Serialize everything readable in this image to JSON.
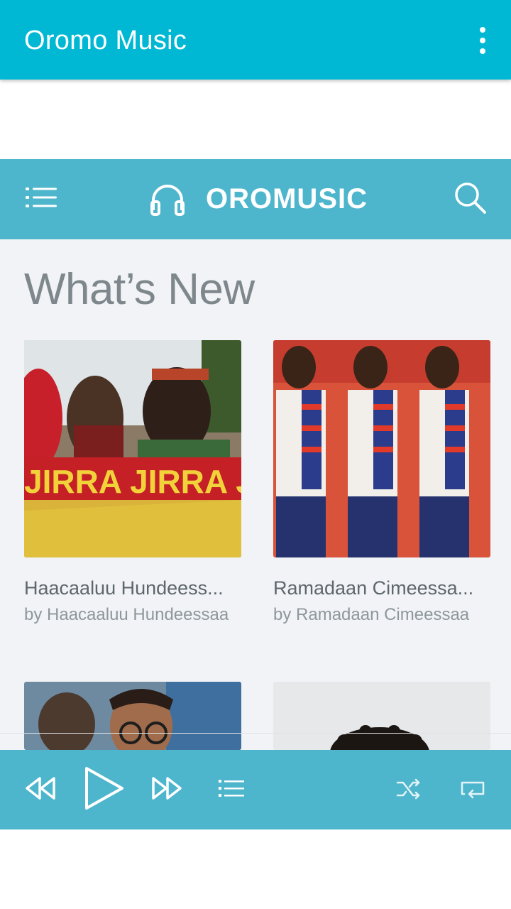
{
  "app": {
    "title": "Oromo Music"
  },
  "site": {
    "brand": "OROMUSIC",
    "section_title": "What’s New"
  },
  "cards": [
    {
      "title": "Haacaaluu Hundeess...",
      "artist": "by Haacaaluu Hundeessaa",
      "art_text": "JIRRA JIRRA J"
    },
    {
      "title": "Ramadaan Cimeessa...",
      "artist": "by Ramadaan Cimeessaa"
    },
    {
      "title": "",
      "artist": ""
    },
    {
      "title": "",
      "artist": ""
    }
  ],
  "colors": {
    "app_bar": "#00B8D4",
    "site_header": "#4DB6CC",
    "player_bar": "#4DB6CC",
    "page_bg": "#F1F3F6"
  },
  "icons": {
    "app_bar": [
      "overflow-menu-icon"
    ],
    "site_header": [
      "list-menu-icon",
      "headphones-icon",
      "search-icon"
    ],
    "player": [
      "rewind-icon",
      "play-icon",
      "fast-forward-icon",
      "playlist-icon",
      "shuffle-icon",
      "repeat-icon"
    ]
  }
}
